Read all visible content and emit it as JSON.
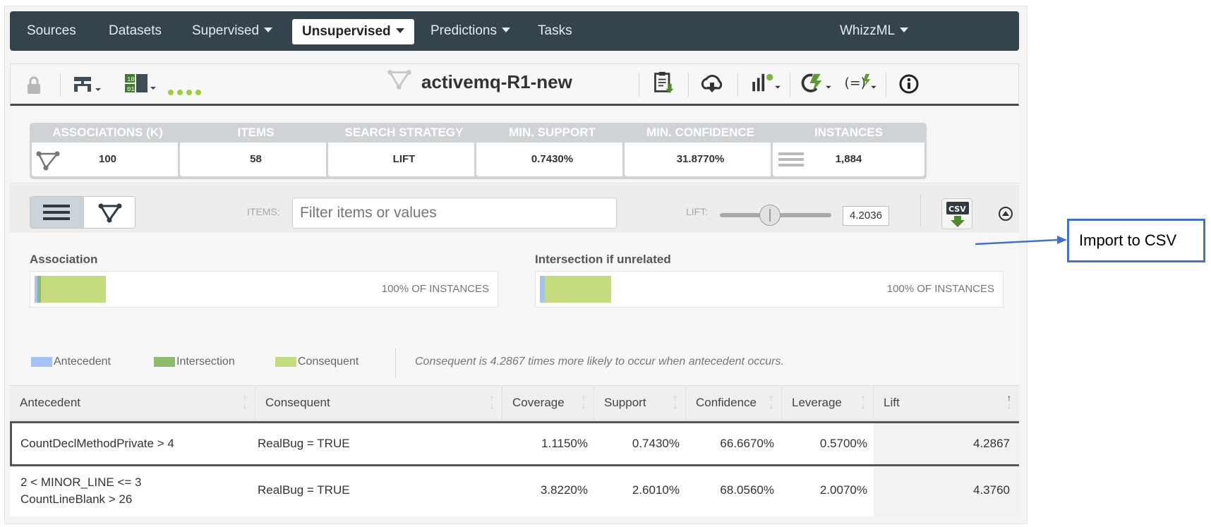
{
  "nav": {
    "items": [
      {
        "label": "Sources"
      },
      {
        "label": "Datasets"
      },
      {
        "label": "Supervised"
      },
      {
        "label": "Unsupervised"
      },
      {
        "label": "Predictions"
      },
      {
        "label": "Tasks"
      },
      {
        "label": "WhizzML"
      }
    ]
  },
  "toolbar": {
    "title": "activemq-R1-new"
  },
  "stats": [
    {
      "label": "ASSOCIATIONS (K)",
      "value": "100"
    },
    {
      "label": "ITEMS",
      "value": "58"
    },
    {
      "label": "SEARCH STRATEGY",
      "value": "LIFT"
    },
    {
      "label": "MIN. SUPPORT",
      "value": "0.7430%"
    },
    {
      "label": "MIN. CONFIDENCE",
      "value": "31.8770%"
    },
    {
      "label": "INSTANCES",
      "value": "1,884"
    }
  ],
  "filter": {
    "items_label": "ITEMS:",
    "placeholder": "Filter items or values",
    "lift_label": "LIFT:",
    "lift_value": "4.2036",
    "lift_slider_fraction": 0.45
  },
  "association": {
    "title": "Association",
    "pct": "100% OF INSTANCES",
    "antecedent_fraction": 0.006,
    "intersection_fraction": 0.007,
    "consequent_fraction": 0.155
  },
  "intersection": {
    "title": "Intersection if unrelated",
    "pct": "100% OF INSTANCES",
    "antecedent_fraction": 0.011,
    "consequent_fraction": 0.155
  },
  "legend": {
    "antecedent": "Antecedent",
    "intersection": "Intersection",
    "consequent": "Consequent",
    "note": "Consequent is 4.2867 times more likely to occur when antecedent occurs."
  },
  "colors": {
    "antecedent": "#a4c2f4",
    "intersection": "#8fbb6d",
    "consequent": "#c4db80",
    "nav_bg": "#34434c"
  },
  "table": {
    "headers": [
      "Antecedent",
      "Consequent",
      "Coverage",
      "Support",
      "Confidence",
      "Leverage",
      "Lift"
    ],
    "rows": [
      {
        "antecedent": [
          "CountDeclMethodPrivate > 4"
        ],
        "consequent": "RealBug = TRUE",
        "coverage": "1.1150%",
        "support": "0.7430%",
        "confidence": "66.6670%",
        "leverage": "0.5700%",
        "lift": "4.2867"
      },
      {
        "antecedent": [
          "2 < MINOR_LINE <= 3",
          "CountLineBlank > 26"
        ],
        "consequent": "RealBug = TRUE",
        "coverage": "3.8220%",
        "support": "2.6010%",
        "confidence": "68.0560%",
        "leverage": "2.0070%",
        "lift": "4.3760"
      }
    ]
  },
  "callout": {
    "label": "Import to CSV"
  }
}
